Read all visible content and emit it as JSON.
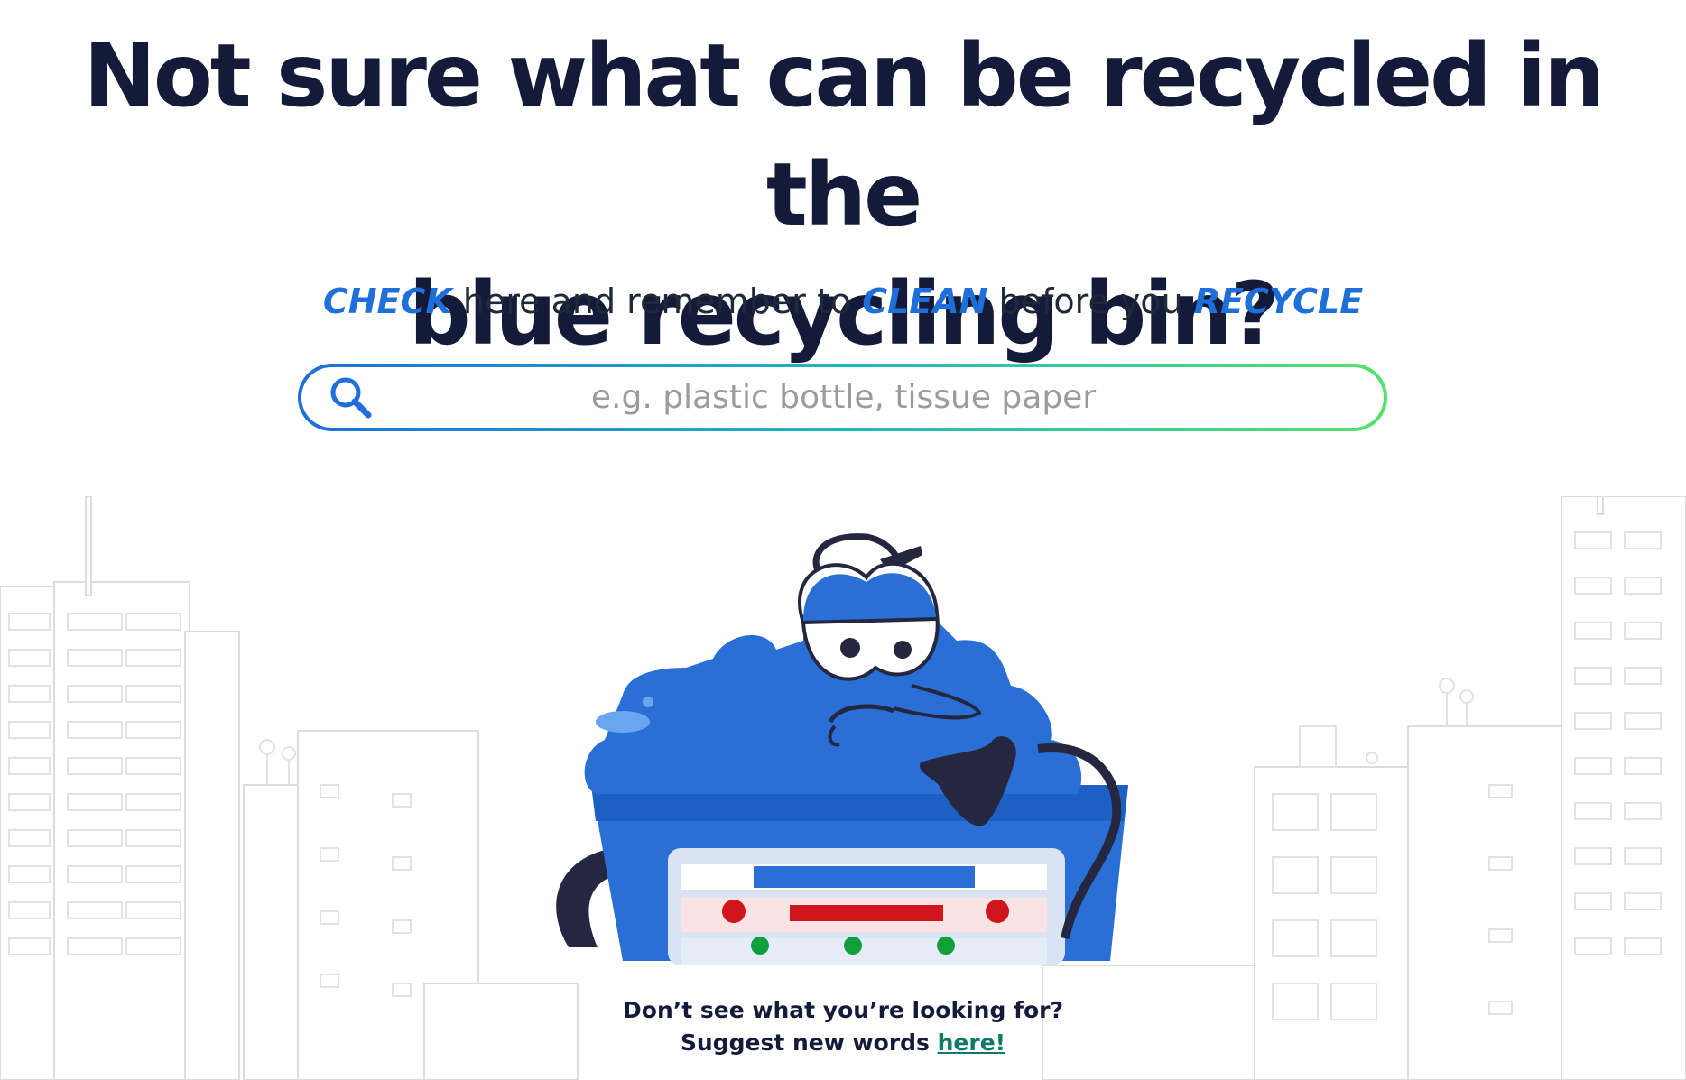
{
  "headline": {
    "line1": "Not sure what can be recycled in the",
    "line2": "blue recycling bin?"
  },
  "tagline": {
    "kw1": "CHECK",
    "text1": " here and remember to ",
    "kw2": "CLEAN",
    "text2": " before you ",
    "kw3": "RECYCLE"
  },
  "search": {
    "placeholder": "e.g. plastic bottle, tissue paper",
    "icon": "search-icon"
  },
  "footer": {
    "line1": "Don’t see what you’re looking for?",
    "line2": "Suggest new words ",
    "link": "here!"
  },
  "colors": {
    "accent_blue": "#1e6fd9",
    "headline": "#141a3a",
    "link": "#0e7a6a",
    "gradient_start": "#1e6fd9",
    "gradient_end": "#55e26a"
  }
}
